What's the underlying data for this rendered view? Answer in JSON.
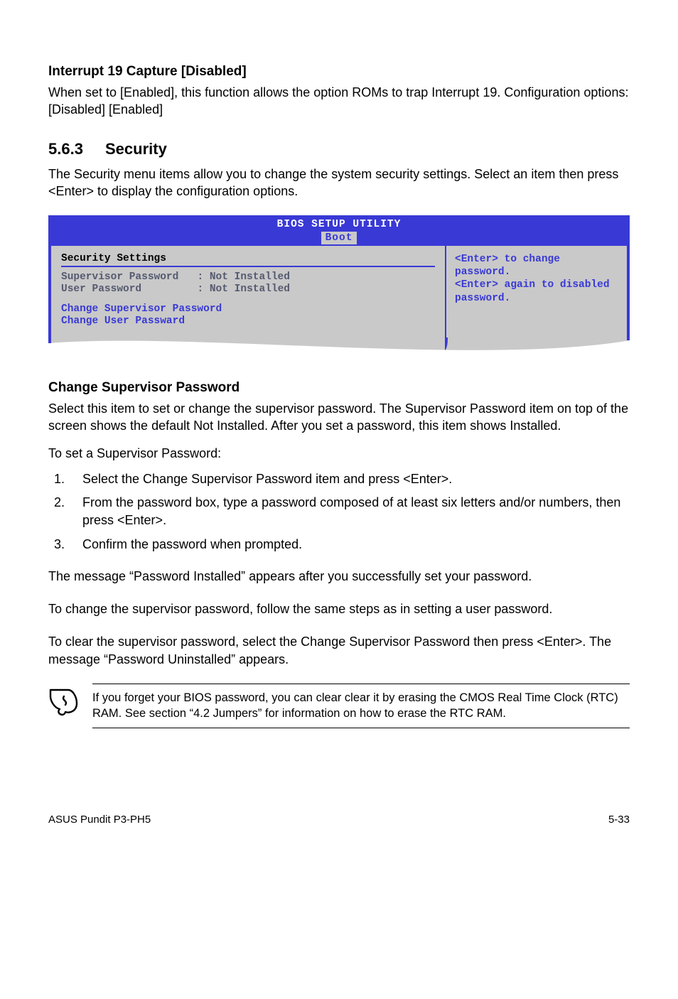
{
  "h1": "Interrupt 19 Capture [Disabled]",
  "p1": "When set to [Enabled], this function allows the option ROMs to trap Interrupt 19. Configuration options: [Disabled] [Enabled]",
  "section_num": "5.6.3",
  "section_title": "Security",
  "p2": "The Security menu items allow you to change the system security settings. Select an item then press <Enter> to display the configuration options.",
  "bios": {
    "header": "BIOS SETUP UTILITY",
    "tab": "Boot",
    "sec_title": "Security Settings",
    "row1_label": "Supervisor Password",
    "row1_value": ": Not Installed",
    "row2_label": "User Password",
    "row2_value": ": Not Installed",
    "link1": "Change Supervisor Password",
    "link2": "Change User Passward",
    "help": "<Enter> to change password.\n<Enter> again to disabled password."
  },
  "h2": "Change Supervisor Password",
  "p3": "Select this item to set or change the supervisor password. The Supervisor Password item on top of the screen shows the default Not Installed. After you set a password, this item shows Installed.",
  "p4": "To set a Supervisor Password:",
  "steps": {
    "s1": "Select the Change Supervisor Password item and press <Enter>.",
    "s2": "From the password box, type a password composed of at least six letters and/or numbers, then press <Enter>.",
    "s3": "Confirm the password when prompted."
  },
  "p5": "The message “Password Installed” appears after you successfully set your password.",
  "p6": "To change the supervisor password, follow the same steps as in setting a user password.",
  "p7": "To clear the supervisor password, select the Change Supervisor Password then press <Enter>. The message “Password Uninstalled” appears.",
  "note": "If you forget your BIOS password, you can clear clear it by erasing the CMOS Real Time Clock (RTC) RAM. See section “4.2 Jumpers” for information on how to erase the RTC RAM.",
  "footer_left": "ASUS Pundit P3-PH5",
  "footer_right": "5-33"
}
